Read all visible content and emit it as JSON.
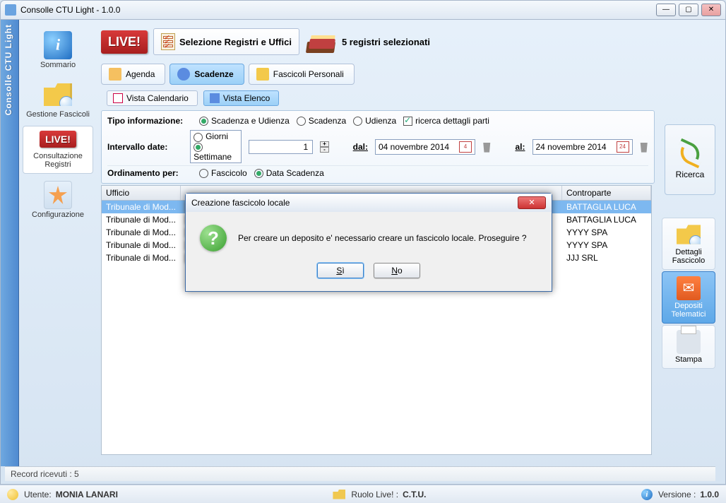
{
  "chrome": {
    "title": "Consolle CTU Light - 1.0.0"
  },
  "vertstrip": "Consolle CTU Light",
  "leftnav": {
    "items": [
      {
        "label": "Sommario"
      },
      {
        "label": "Gestione Fascicoli"
      },
      {
        "label": "Consultazione Registri"
      },
      {
        "label": "Configurazione"
      }
    ]
  },
  "top": {
    "live_badge": "LIVE!",
    "sel_button": "Selezione Registri e Uffici",
    "reg_text": "5 registri selezionati"
  },
  "tabs": [
    "Agenda",
    "Scadenze",
    "Fascicoli Personali"
  ],
  "subtabs": [
    "Vista Calendario",
    "Vista Elenco"
  ],
  "filter": {
    "tipo_label": "Tipo informazione:",
    "r1": "Scadenza e Udienza",
    "r2": "Scadenza",
    "r3": "Udienza",
    "chk": "ricerca dettagli parti",
    "interv_label": "Intervallo date:",
    "g": "Giorni",
    "s": "Settimane",
    "num": "1",
    "dal": "dal:",
    "al": "al:",
    "date_from": "04 novembre 2014",
    "cal_from": "4",
    "date_to": "24 novembre 2014",
    "cal_to": "24",
    "ord_label": "Ordinamento per:",
    "ord1": "Fascicolo",
    "ord2": "Data Scadenza"
  },
  "ricerca": "Ricerca",
  "table": {
    "head_ufficio": "Ufficio",
    "head_contro": "Controparte",
    "rows": [
      {
        "uff": "Tribunale di Mod...",
        "contro": "BATTAGLIA LUCA"
      },
      {
        "uff": "Tribunale di Mod...",
        "contro": "BATTAGLIA LUCA"
      },
      {
        "uff": "Tribunale di Mod...",
        "contro": "YYYY SPA"
      },
      {
        "uff": "Tribunale di Mod...",
        "contro": "YYYY SPA"
      },
      {
        "uff": "Tribunale di Mod...",
        "contro": "JJJ SRL"
      }
    ]
  },
  "right": {
    "dettagli": "Dettagli Fascicolo",
    "depositi": "Depositi Telematici",
    "stampa": "Stampa"
  },
  "footer": "Record ricevuti : 5",
  "dialog": {
    "title": "Creazione fascicolo locale",
    "msg": "Per creare un deposito e' necessario creare un fascicolo locale. Proseguire ?",
    "yes": "Sì",
    "no": "No",
    "close": "✕"
  },
  "status": {
    "utente_label": "Utente:",
    "utente": "MONIA LANARI",
    "ruolo_label": "Ruolo Live! :",
    "ruolo": "C.T.U.",
    "versione_label": "Versione :",
    "versione": "1.0.0"
  }
}
